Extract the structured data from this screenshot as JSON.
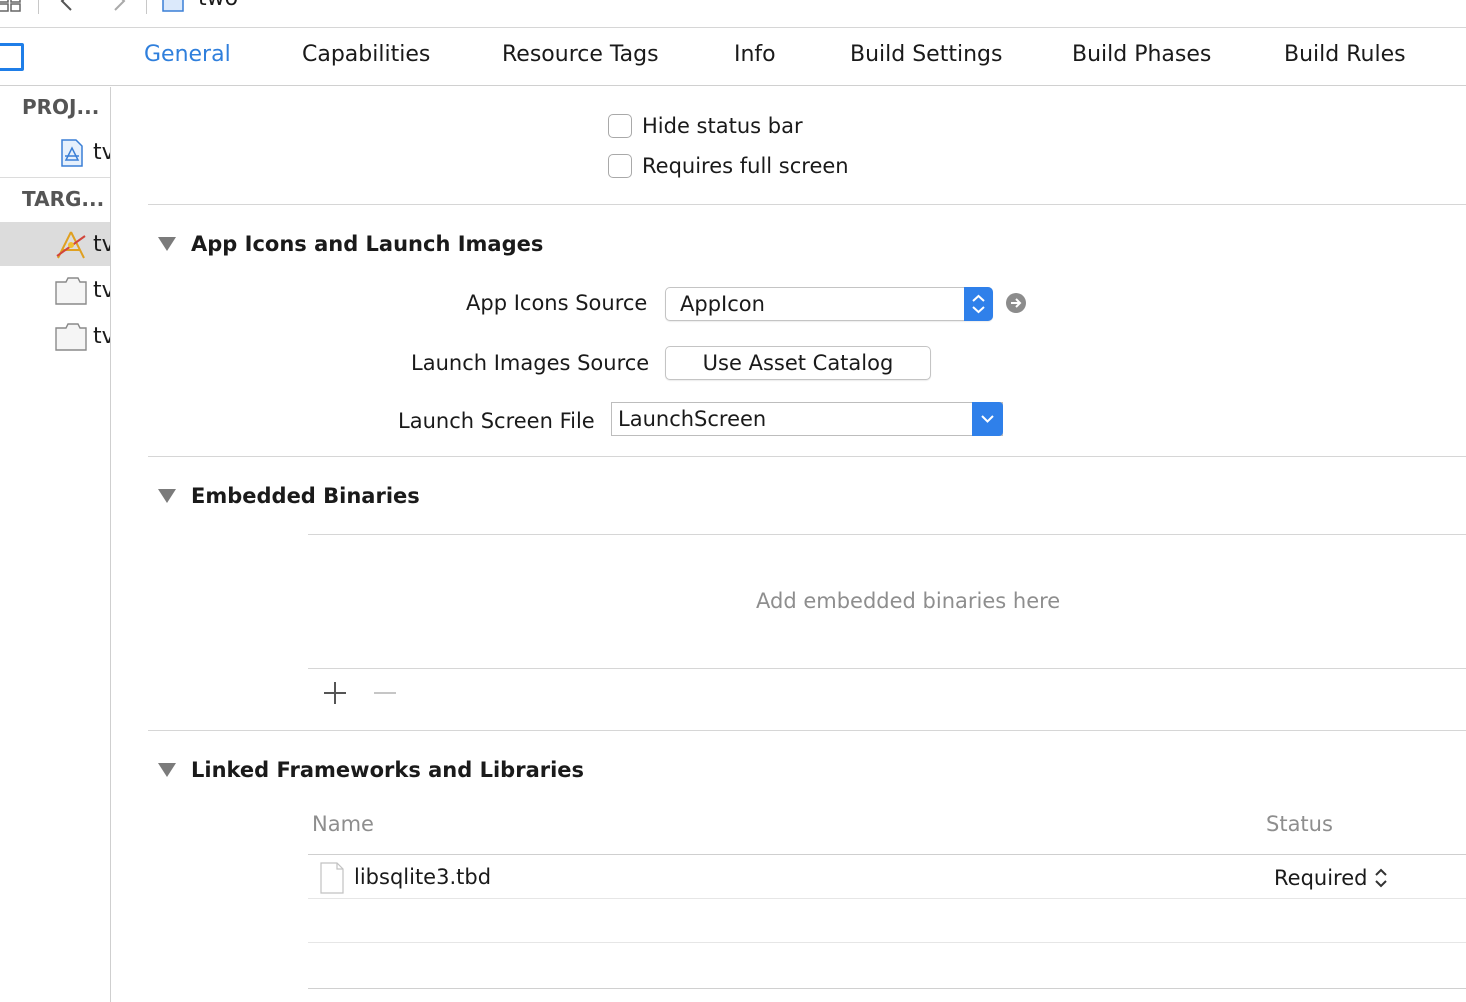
{
  "window": {
    "breadcrumb": "two"
  },
  "tabs": [
    {
      "label": "General",
      "active": true
    },
    {
      "label": "Capabilities"
    },
    {
      "label": "Resource Tags"
    },
    {
      "label": "Info"
    },
    {
      "label": "Build Settings"
    },
    {
      "label": "Build Phases"
    },
    {
      "label": "Build Rules"
    }
  ],
  "sidebar": {
    "project_header": "PROJ...",
    "project_items": [
      {
        "label": "tv"
      }
    ],
    "targets_header": "TARG...",
    "target_items": [
      {
        "label": "tv",
        "selected": true,
        "icon": "app-target-icon"
      },
      {
        "label": "tv",
        "icon": "bundle-target-icon"
      },
      {
        "label": "tv",
        "icon": "bundle-target-icon"
      }
    ]
  },
  "deployment": {
    "hide_status_bar": {
      "label": "Hide status bar",
      "checked": false
    },
    "requires_full_screen": {
      "label": "Requires full screen",
      "checked": false
    }
  },
  "app_icons": {
    "title": "App Icons and Launch Images",
    "icons_source_label": "App Icons Source",
    "icons_source_value": "AppIcon",
    "launch_images_label": "Launch Images Source",
    "launch_images_button": "Use Asset Catalog",
    "launch_screen_label": "Launch Screen File",
    "launch_screen_value": "LaunchScreen"
  },
  "embedded": {
    "title": "Embedded Binaries",
    "placeholder": "Add embedded binaries here"
  },
  "linked": {
    "title": "Linked Frameworks and Libraries",
    "col_name": "Name",
    "col_status": "Status",
    "rows": [
      {
        "name": "libsqlite3.tbd",
        "status": "Required"
      }
    ]
  },
  "colors": {
    "accent": "#2f7fdc",
    "popup_blue": "#2f80ea",
    "muted_text": "#8e8e8e"
  }
}
